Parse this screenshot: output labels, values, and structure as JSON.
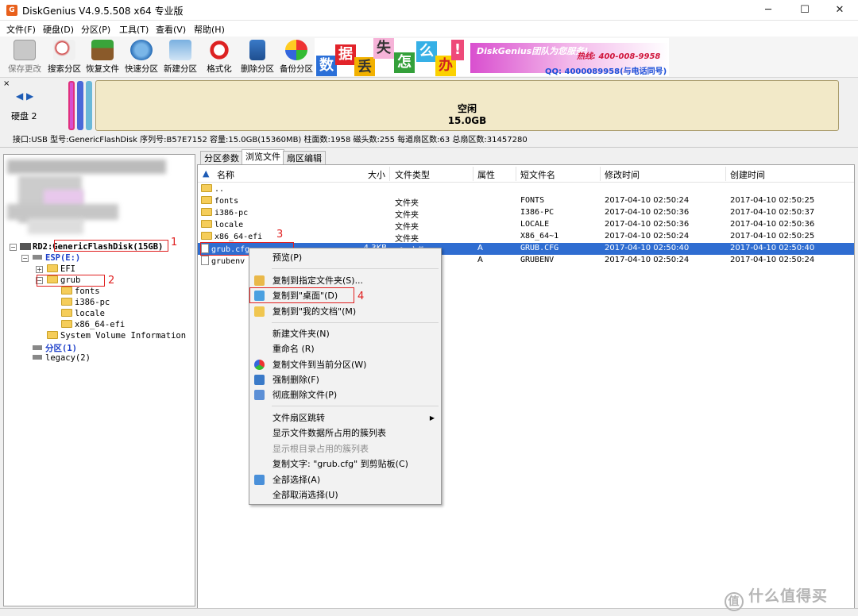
{
  "window": {
    "title": "DiskGenius V4.9.5.508 x64 专业版",
    "app_icon": "G",
    "controls": [
      "─",
      "☐",
      "✕"
    ]
  },
  "menu": [
    "文件(F)",
    "硬盘(D)",
    "分区(P)",
    "工具(T)",
    "查看(V)",
    "帮助(H)"
  ],
  "toolbar": [
    "保存更改",
    "搜索分区",
    "恢复文件",
    "快速分区",
    "新建分区",
    "格式化",
    "删除分区",
    "备份分区"
  ],
  "banner": {
    "chars": [
      "数",
      "据",
      "丢",
      "失",
      "怎",
      "么",
      "办",
      "!"
    ],
    "slogan": "DiskGenius团队为您服务!",
    "hotline": "热线: 400-008-9958",
    "qq": "QQ: 4000089958(与电话同号)"
  },
  "disk": {
    "nav": "◀ ▶",
    "label": "硬盘 2",
    "bar_label": "空闲",
    "bar_size": "15.0GB",
    "info": "接口:USB   型号:GenericFlashDisk  序列号:B57E7152  容量:15.0GB(15360MB)  柱面数:1958  磁头数:255  每道扇区数:63  总扇区数:31457280"
  },
  "tree": {
    "disk": "RD2:GenericFlashDisk(15GB)",
    "esp": "ESP(E:)",
    "efi": "EFI",
    "grub": "grub",
    "grub_children": [
      "fonts",
      "i386-pc",
      "locale",
      "x86_64-efi"
    ],
    "svi": "System Volume Information",
    "part1": "分区(1)",
    "legacy": "legacy(2)"
  },
  "annotations": [
    "1",
    "2",
    "3",
    "4"
  ],
  "tabs": [
    "分区参数",
    "浏览文件",
    "扇区编辑"
  ],
  "columns": [
    "名称",
    "大小",
    "文件类型",
    "属性",
    "短文件名",
    "修改时间",
    "创建时间"
  ],
  "files": [
    {
      "name": "..",
      "size": "",
      "type": "",
      "attr": "",
      "short": "",
      "mtime": "",
      "ctime": ""
    },
    {
      "name": "fonts",
      "size": "",
      "type": "文件夹",
      "attr": "",
      "short": "FONTS",
      "mtime": "2017-04-10 02:50:24",
      "ctime": "2017-04-10 02:50:25"
    },
    {
      "name": "i386-pc",
      "size": "",
      "type": "文件夹",
      "attr": "",
      "short": "I386-PC",
      "mtime": "2017-04-10 02:50:36",
      "ctime": "2017-04-10 02:50:37"
    },
    {
      "name": "locale",
      "size": "",
      "type": "文件夹",
      "attr": "",
      "short": "LOCALE",
      "mtime": "2017-04-10 02:50:36",
      "ctime": "2017-04-10 02:50:36"
    },
    {
      "name": "x86_64-efi",
      "size": "",
      "type": "文件夹",
      "attr": "",
      "short": "X86_64~1",
      "mtime": "2017-04-10 02:50:24",
      "ctime": "2017-04-10 02:50:25"
    },
    {
      "name": "grub.cfg",
      "size": "4.3KB",
      "type": "cfg 文件",
      "attr": "A",
      "short": "GRUB.CFG",
      "mtime": "2017-04-10 02:50:40",
      "ctime": "2017-04-10 02:50:40"
    },
    {
      "name": "grubenv",
      "size": "",
      "type": "",
      "attr": "A",
      "short": "GRUBENV",
      "mtime": "2017-04-10 02:50:24",
      "ctime": "2017-04-10 02:50:24"
    }
  ],
  "context_menu": [
    "预览(P)",
    "复制到指定文件夹(S)...",
    "复制到\"桌面\"(D)",
    "复制到\"我的文档\"(M)",
    "新建文件夹(N)",
    "重命名 (R)",
    "复制文件到当前分区(W)",
    "强制删除(F)",
    "彻底删除文件(P)",
    "文件扇区跳转",
    "显示文件数据所占用的簇列表",
    "显示根目录占用的簇列表",
    "复制文字: \"grub.cfg\" 到剪贴板(C)",
    "全部选择(A)",
    "全部取消选择(U)"
  ],
  "watermark": "什么值得买",
  "colors": {
    "selection": "#2f6dd1",
    "annotation": "#e02020",
    "free_space": "#f2e9c8"
  }
}
